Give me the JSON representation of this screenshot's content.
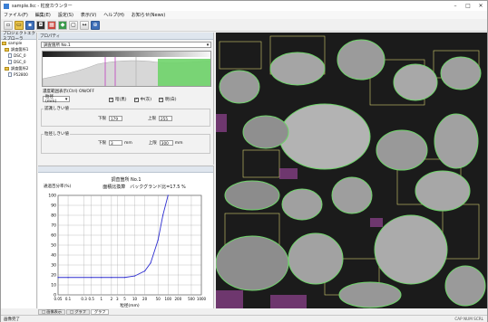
{
  "window": {
    "title": "sample.lkc - 粒度カウンター"
  },
  "menu": [
    "ファイル(F)",
    "編集(E)",
    "設定(S)",
    "表示(V)",
    "ヘルプ(H)",
    "お知らせ(News)"
  ],
  "tree": {
    "header": "プロジェクトエクスプローラ",
    "items": [
      "sample",
      "調査箇所1",
      "DSC_0",
      "DSC_0",
      "調査箇所2",
      "P52800"
    ]
  },
  "settings": {
    "header": "プロパティ",
    "location_label": "調査箇所 No.1",
    "range_label": "濃度範囲表示(Ctrl) ON/OFF",
    "mode_value": "粒径(mm)",
    "checks": [
      "暗(黒)",
      "中(灰)",
      "明(白)"
    ],
    "lower_group": "認識しきい値",
    "lower_min_label": "下限",
    "lower_min_value": "179",
    "lower_max_label": "上限",
    "lower_max_value": "255",
    "size_group": "粒径しきい値",
    "size_min_label": "下限",
    "size_min_value": "3",
    "size_min_unit": "mm",
    "size_max_label": "上限",
    "size_max_value": "300",
    "size_max_unit": "mm"
  },
  "graph": {
    "title": "調査箇所 No.1",
    "subtitle": "面積比換算　バックグランド比=17.5 %",
    "ylabel": "通過百分率(%)"
  },
  "chart_data": {
    "type": "line",
    "title": "調査箇所 No.1",
    "subtitle": "面積比換算　バックグランド比=17.5 %",
    "xlabel": "粒径(mm)",
    "ylabel": "通過百分率(%)",
    "x_scale": "log",
    "x_tick_labels": [
      "0.05",
      "0.1",
      "0.3",
      "0.5",
      "1",
      "2",
      "3",
      "5",
      "10",
      "20",
      "50",
      "100",
      "200",
      "500",
      "1000"
    ],
    "y_ticks": [
      0,
      10,
      20,
      30,
      40,
      50,
      60,
      70,
      80,
      90,
      100
    ],
    "ylim": [
      0,
      100
    ],
    "grid": true,
    "series": [
      {
        "x": [
          0.05,
          0.1,
          0.5,
          1,
          2,
          5,
          10,
          20,
          30,
          50,
          70,
          100
        ],
        "y": [
          17.5,
          17.5,
          17.5,
          17.5,
          17.5,
          17.5,
          19,
          24,
          32,
          55,
          80,
          100
        ],
        "color": "#2f2fd0"
      }
    ]
  },
  "bottom_tabs": [
    "□ 画像表示",
    "□ グラフ",
    "グラフ"
  ],
  "status": {
    "left": "画像完了",
    "right": "CAP NUM SCRL"
  },
  "toolbar": {
    "icons": [
      "new-file-icon",
      "open-folder-icon",
      "save-icon",
      "camera-icon",
      "grid-icon",
      "color-icon",
      "select-icon",
      "arrow-icon",
      "zoom-icon"
    ]
  },
  "colors": {
    "accent": "#3e6fb8",
    "curve": "#2f2fd0",
    "highlight": "#6fd46a",
    "outline": "#e6e27a"
  }
}
